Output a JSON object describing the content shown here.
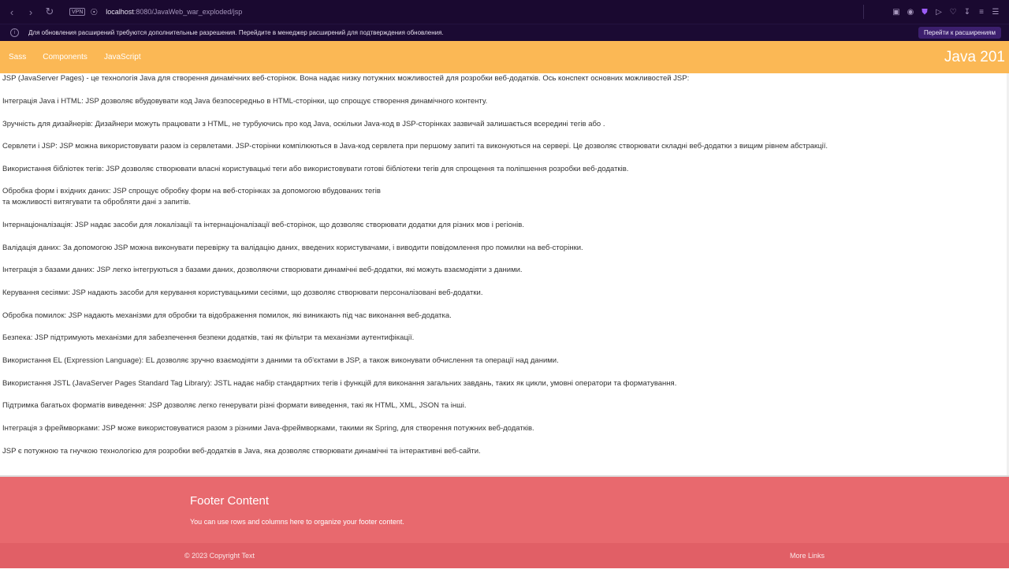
{
  "browser": {
    "back_icon": "chevron-left-icon",
    "forward_icon": "chevron-right-icon",
    "reload_icon": "reload-icon",
    "vpn_label": "VPN",
    "url_host": "localhost",
    "url_rest": ":8080/JavaWeb_war_exploded/jsp",
    "toolbar_icons": [
      "image-search-icon",
      "camera-icon",
      "shield-icon",
      "play-icon",
      "heart-icon",
      "download-icon",
      "settings-icon",
      "menu-icon"
    ]
  },
  "notification": {
    "text": "Для обновления расширений требуются дополнительные разрешения. Перейдите в менеджер расширений для подтверждения обновления.",
    "button": "Перейти к расширениям"
  },
  "header": {
    "nav": [
      "Sass",
      "Components",
      "JavaScript"
    ],
    "brand": "Java 201",
    "bg_color": "#fbb855"
  },
  "content": {
    "paragraphs": [
      "JSP (JavaServer Pages) - це технологія Java для створення динамічних веб-сторінок. Вона надає низку потужних можливостей для розробки веб-додатків. Ось конспект основних можливостей JSP:",
      "Інтеграція Java і HTML: JSP дозволяє вбудовувати код Java безпосередньо в HTML-сторінки, що спрощує створення динамічного контенту.",
      "Зручність для дизайнерів: Дизайнери можуть працювати з HTML, не турбуючись про код Java, оскільки Java-код в JSP-сторінках зазвичай залишається всередині тегів або .",
      "Сервлети і JSP: JSP можна використовувати разом із сервлетами. JSP-сторінки компілюються в Java-код сервлета при першому запиті та виконуються на сервері. Це дозволяє створювати складні веб-додатки з вищим рівнем абстракції.",
      "Використання бібліотек тегів: JSP дозволяє створювати власні користувацькі теги або використовувати готові бібліотеки тегів для спрощення та поліпшення розробки веб-додатків.",
      "Обробка форм і вхідних даних: JSP спрощує обробку форм на веб-сторінках за допомогою вбудованих тегів",
      "та можливості витягувати та обробляти дані з запитів.",
      "Інтернаціоналізація: JSP надає засоби для локалізації та інтернаціоналізації веб-сторінок, що дозволяє створювати додатки для різних мов і регіонів.",
      "Валідація даних: За допомогою JSP можна виконувати перевірку та валідацію даних, введених користувачами, і виводити повідомлення про помилки на веб-сторінки.",
      "Інтеграція з базами даних: JSP легко інтегруються з базами даних, дозволяючи створювати динамічні веб-додатки, які можуть взаємодіяти з даними.",
      "Керування сесіями: JSP надають засоби для керування користувацькими сесіями, що дозволяє створювати персоналізовані веб-додатки.",
      "Обробка помилок: JSP надають механізми для обробки та відображення помилок, які виникають під час виконання веб-додатка.",
      "Безпека: JSP підтримують механізми для забезпечення безпеки додатків, такі як фільтри та механізми аутентифікації.",
      "Використання EL (Expression Language): EL дозволяє зручно взаємодіяти з даними та об'єктами в JSP, а також виконувати обчислення та операції над даними.",
      "Використання JSTL (JavaServer Pages Standard Tag Library): JSTL надає набір стандартних тегів і функцій для виконання загальних завдань, таких як цикли, умовні оператори та форматування.",
      "Підтримка багатьох форматів виведення: JSP дозволяє легко генерувати різні формати виведення, такі як HTML, XML, JSON та інші.",
      "Інтеграція з фреймворками: JSP може використовуватися разом з різними Java-фреймворками, такими як Spring, для створення потужних веб-додатків.",
      "JSP є потужною та гнучкою технологією для розробки веб-додатків в Java, яка дозволяє створювати динамічні та інтерактивні веб-сайти."
    ]
  },
  "footer": {
    "title": "Footer Content",
    "text": "You can use rows and columns here to organize your footer content.",
    "copyright": "© 2023 Copyright Text",
    "more_links": "More Links",
    "bg_color": "#e8696e"
  }
}
